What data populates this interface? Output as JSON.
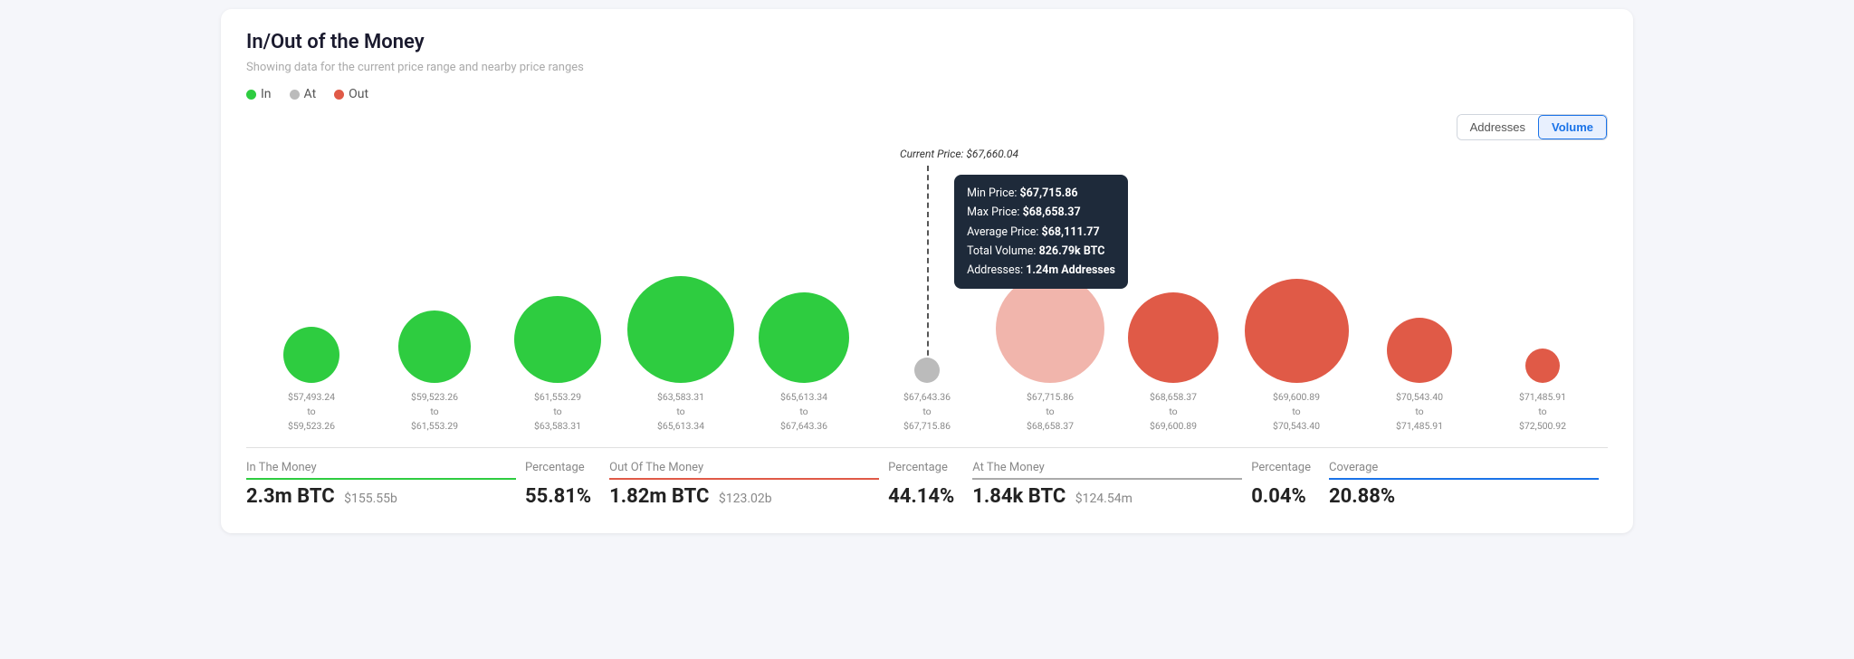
{
  "title": "In/Out of the Money",
  "subtitle": "Showing data for the current price range and nearby ranges",
  "legend": [
    {
      "label": "In",
      "color": "#2ecc40"
    },
    {
      "label": "At",
      "color": "#bbb"
    },
    {
      "label": "Out",
      "color": "#e05a47"
    }
  ],
  "controls": {
    "addresses_label": "Addresses",
    "volume_label": "Volume",
    "active": "volume"
  },
  "current_price_label": "Current Price: $67,660.04",
  "bubbles": [
    {
      "type": "green",
      "size": 62,
      "range1": "$57,493.24",
      "range2": "to",
      "range3": "$59,523.26",
      "range_to": "$59,523.26"
    },
    {
      "type": "green",
      "size": 80,
      "range1": "$59,523.26",
      "range2": "to",
      "range3": "$61,553.29",
      "range_to": "$61,553.29"
    },
    {
      "type": "green",
      "size": 96,
      "range1": "$61,553.29",
      "range2": "to",
      "range3": "$63,583.31",
      "range_to": "$63,583.31"
    },
    {
      "type": "green",
      "size": 118,
      "range1": "$63,583.31",
      "range2": "to",
      "range3": "$65,613.34",
      "range_to": "$65,613.34"
    },
    {
      "type": "green",
      "size": 100,
      "range1": "$65,613.34",
      "range2": "to",
      "range3": "$67,643.36",
      "range_to": "$67,643.36"
    },
    {
      "type": "gray",
      "size": 28,
      "range1": "$67,643.36",
      "range2": "to",
      "range3": "$67,715.86",
      "range_to": "$67,715.86"
    },
    {
      "type": "red-faded",
      "size": 120,
      "range1": "$67,715.86",
      "range2": "to",
      "range3": "$68,658.37",
      "range_to": "$68,658.37",
      "tooltip": true
    },
    {
      "type": "red",
      "size": 100,
      "range1": "$68,658.37",
      "range2": "to",
      "range3": "$69,600.89",
      "range_to": "$69,600.89"
    },
    {
      "type": "red",
      "size": 115,
      "range1": "$69,600.89",
      "range2": "to",
      "range3": "$70,543.40",
      "range_to": "$70,543.40"
    },
    {
      "type": "red",
      "size": 72,
      "range1": "$70,543.40",
      "range2": "to",
      "range3": "$71,485.91",
      "range_to": "$71,485.91"
    },
    {
      "type": "red",
      "size": 38,
      "range1": "$71,485.91",
      "range2": "to",
      "range3": "$72,500.92",
      "range_to": "$72,500.92"
    }
  ],
  "tooltip": {
    "min_price_label": "Min Price:",
    "min_price_value": "$67,715.86",
    "max_price_label": "Max Price:",
    "max_price_value": "$68,658.37",
    "avg_price_label": "Average Price:",
    "avg_price_value": "$68,111.77",
    "volume_label": "Total Volume:",
    "volume_value": "826.79k BTC",
    "addresses_label": "Addresses:",
    "addresses_value": "1.24m Addresses"
  },
  "stats": [
    {
      "label": "In The Money",
      "border": "green-border",
      "btc": "2.3m BTC",
      "usd": "$155.55b",
      "pct": "55.81%",
      "pct_border": "gray-border"
    },
    {
      "label": "Out Of The Money",
      "border": "red-border",
      "btc": "1.82m BTC",
      "usd": "$123.02b",
      "pct": "44.14%",
      "pct_border": "gray-border"
    },
    {
      "label": "At The Money",
      "border": "gray-border",
      "btc": "1.84k BTC",
      "usd": "$124.54m",
      "pct": "0.04%",
      "pct_border": "gray-border"
    },
    {
      "label": "Coverage",
      "border": "blue-border",
      "value": "20.88%"
    }
  ]
}
